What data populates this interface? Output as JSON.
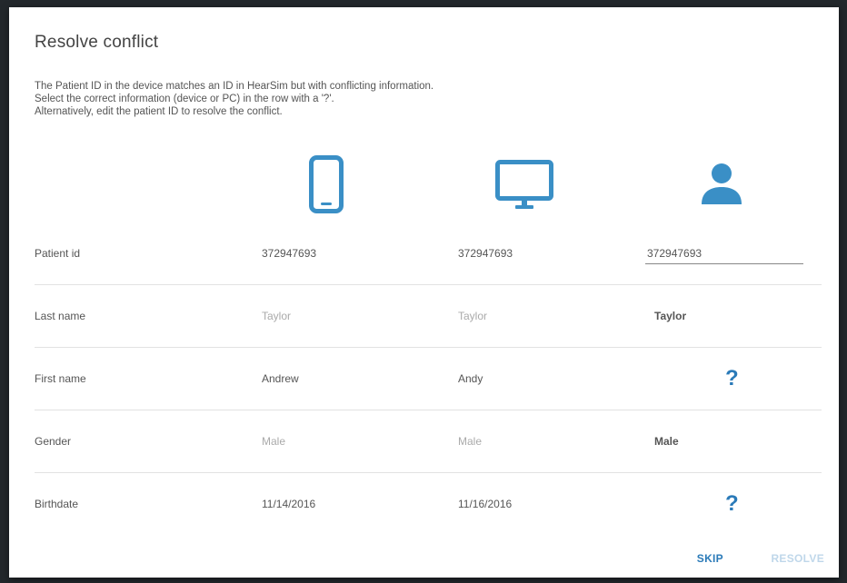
{
  "dialog": {
    "title": "Resolve conflict",
    "description": [
      "The Patient ID in the device matches an ID in HearSim but with conflicting information.",
      "Select the correct information (device or PC) in the row with a '?'.",
      "Alternatively, edit the patient ID to resolve the conflict."
    ]
  },
  "columns": {
    "device_icon": "mobile-phone-icon",
    "pc_icon": "monitor-icon",
    "resolved_icon": "person-icon",
    "accent_color": "#3a8fc6"
  },
  "rows": [
    {
      "label": "Patient id",
      "device": "372947693",
      "pc": "372947693",
      "resolved": "372947693"
    },
    {
      "label": "Last name",
      "device": "Taylor",
      "pc": "Taylor",
      "resolved": "Taylor"
    },
    {
      "label": "First name",
      "device": "Andrew",
      "pc": "Andy",
      "resolved": "?"
    },
    {
      "label": "Gender",
      "device": "Male",
      "pc": "Male",
      "resolved": "Male"
    },
    {
      "label": "Birthdate",
      "device": "11/14/2016",
      "pc": "11/16/2016",
      "resolved": "?"
    }
  ],
  "actions": {
    "skip": "SKIP",
    "resolve": "RESOLVE"
  },
  "colors": {
    "primary": "#2a7ab8",
    "disabled": "#bfd7ea",
    "muted_text": "#aaaaaa"
  }
}
